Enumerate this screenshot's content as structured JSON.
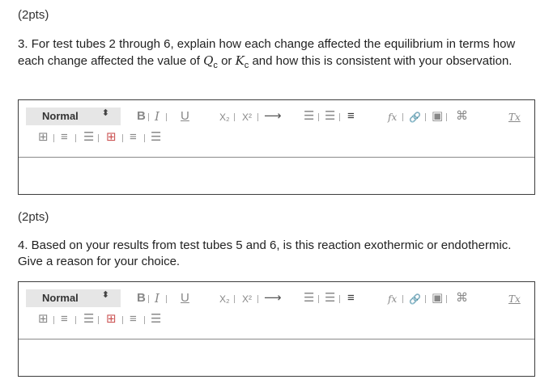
{
  "questions": [
    {
      "points": "(2pts)",
      "number": "3.",
      "text_part1": "For test tubes 2 through 6, explain how each change affected the equilibrium in terms how each change affected the value of",
      "q_symbol": "Q",
      "q_sub": "c",
      "or": "or",
      "k_symbol": "K",
      "k_sub": "c",
      "text_part2": "and how this is consistent with your observation."
    },
    {
      "points": "(2pts)",
      "text": "4. Based on your results from test tubes 5 and 6, is this reaction exothermic or endothermic. Give a reason for your choice."
    }
  ],
  "toolbar": {
    "style_value": "Normal",
    "style_caret": "⬍",
    "bold": "B",
    "italic": "I",
    "underline": "U",
    "subscript": "X₂",
    "superscript": "X²",
    "arrow": "⟶",
    "ordered_list": "☰",
    "unordered_list": "☰",
    "align": "≡",
    "formula": "fx",
    "link": "🔗",
    "image": "▣",
    "attach": "⌘",
    "clear_format": "Tx",
    "table": "⊞",
    "icons": [
      "table-icon",
      "insert-row-icon",
      "insert-column-icon",
      "delete-table-icon",
      "delete-row-icon",
      "delete-column-icon"
    ]
  }
}
